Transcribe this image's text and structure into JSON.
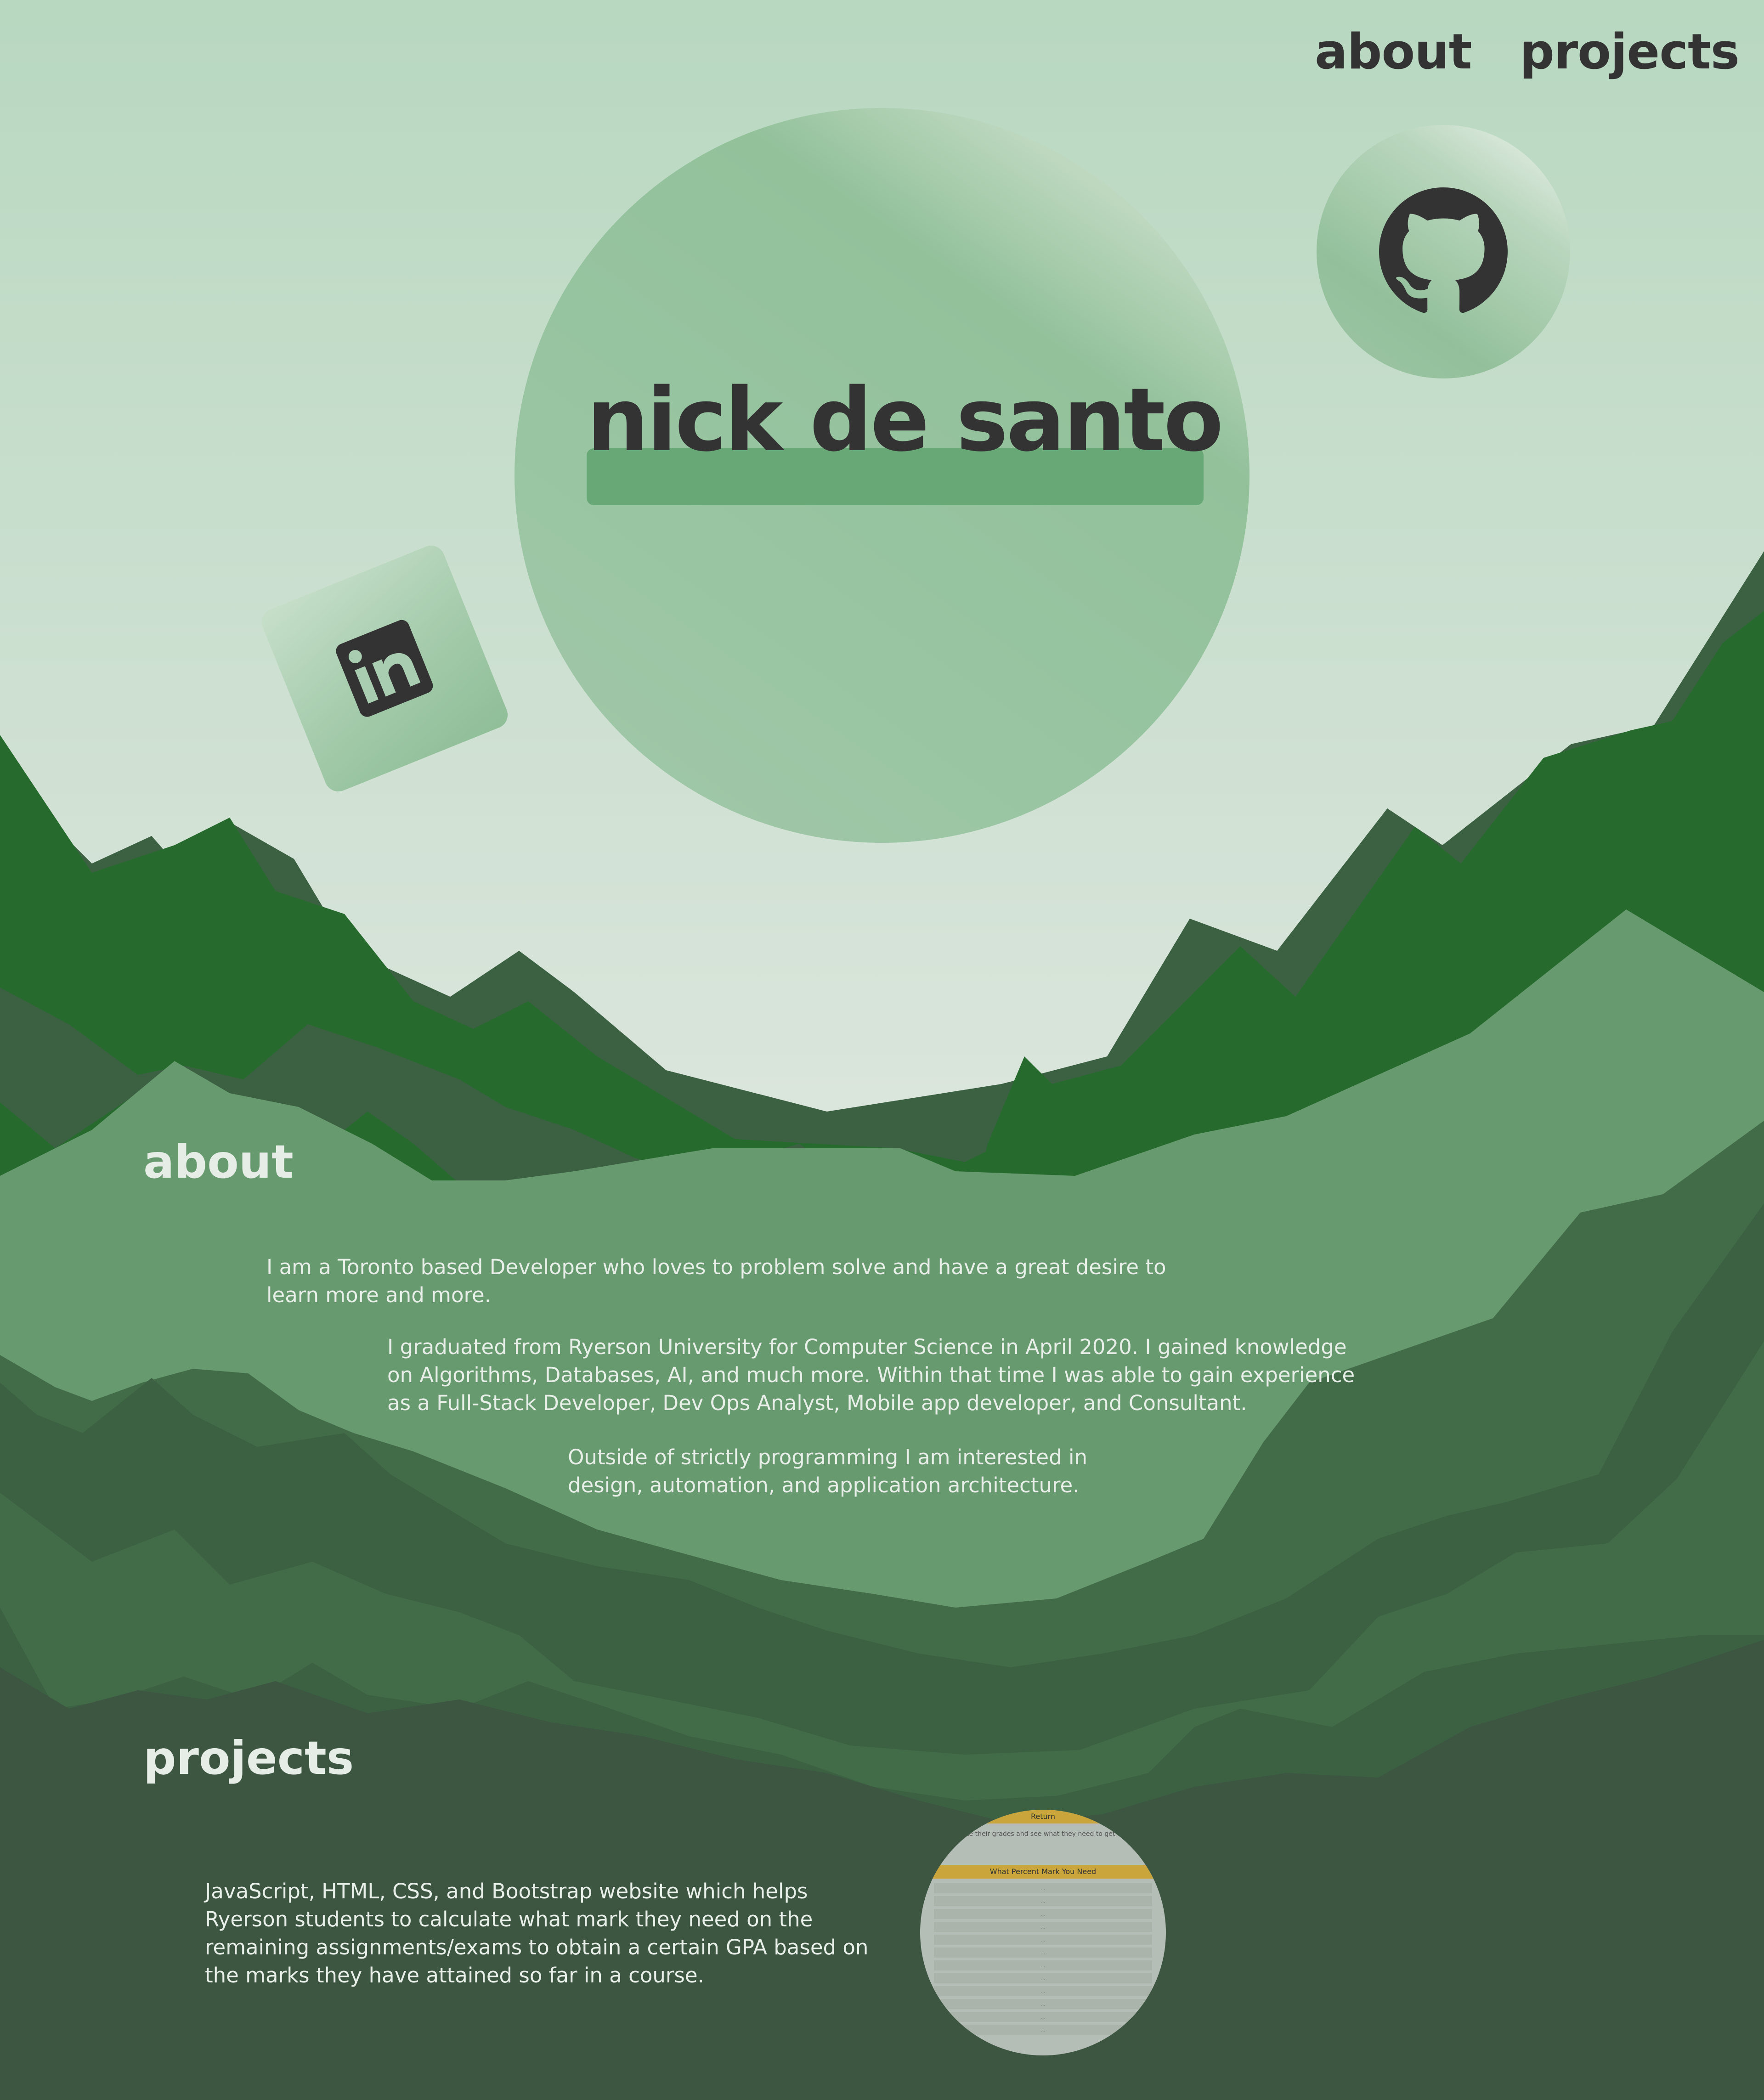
{
  "nav": {
    "about": "about",
    "projects": "projects"
  },
  "hero": {
    "name": "nick de santo"
  },
  "social": {
    "github_icon": "github-icon",
    "linkedin_icon": "linkedin-icon"
  },
  "about": {
    "title": "about",
    "paragraphs": [
      "I am a Toronto based Developer who loves to problem solve and have a great desire to learn more and more.",
      "I graduated from Ryerson University for Computer Science in April 2020. I gained knowledge on Algorithms, Databases, AI, and much more. Within that time I was able to gain experience as a Full-Stack Developer, Dev Ops Analyst, Mobile app developer, and Consultant.",
      "Outside of strictly programming I am interested in design, automation, and application architecture."
    ]
  },
  "projects": {
    "title": "projects",
    "items": [
      {
        "description": "JavaScript, HTML, CSS, and Bootstrap website which helps Ryerson students to calculate what mark they need on the remaining assignments/exams to obtain a certain GPA based on the marks they have attained so far in a course.",
        "thumbnail": {
          "header": "Return",
          "text": "n to calculate their grades and see what they need to get on their final exam. It also gives the average that the student currently has",
          "subheader": "What Percent Mark You Need",
          "row_placeholder": "..."
        }
      }
    ]
  },
  "colors": {
    "sky_top": "#b8d8c0",
    "sky_bottom": "#dde6de",
    "mountain_far": "#3b6142",
    "mountain_bright": "#266b2d",
    "mountain_pale": "#679a6e",
    "mountain_mid": "#426b48",
    "mountain_dark": "#3d5641",
    "text_dark": "#333333",
    "text_light": "#e8eee8"
  }
}
